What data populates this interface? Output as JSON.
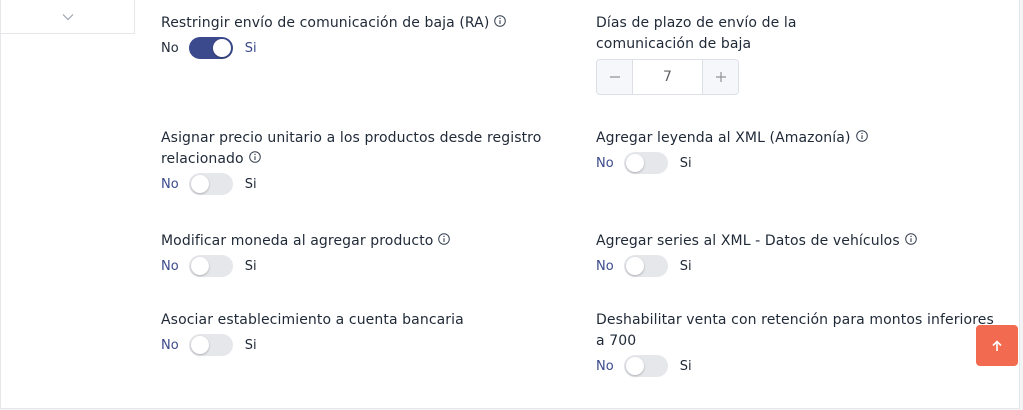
{
  "settings": {
    "restrict_ra": {
      "label": "Restringir envío de comunicación de baja (RA)",
      "no": "No",
      "yes": "Si",
      "state": "on"
    },
    "days_term": {
      "label_line1": "Días de plazo de envío de la",
      "label_line2": "comunicación de baja",
      "value": "7"
    },
    "assign_price": {
      "label_line1": "Asignar precio unitario a los productos desde registro",
      "label_line2": "relacionado",
      "no": "No",
      "yes": "Si",
      "state": "off"
    },
    "xml_legend": {
      "label": "Agregar leyenda al XML (Amazonía)",
      "no": "No",
      "yes": "Si",
      "state": "off"
    },
    "modify_currency": {
      "label": "Modificar moneda al agregar producto",
      "no": "No",
      "yes": "Si",
      "state": "off"
    },
    "xml_series": {
      "label": "Agregar series al XML - Datos de vehículos",
      "no": "No",
      "yes": "Si",
      "state": "off"
    },
    "bank_account": {
      "label": "Asociar establecimiento a cuenta bancaria",
      "no": "No",
      "yes": "Si",
      "state": "off"
    },
    "disable_retention": {
      "label_line1": "Deshabilitar venta con retención para montos inferiores",
      "label_line2": "a 700",
      "no": "No",
      "yes": "Si",
      "state": "off"
    }
  },
  "colors": {
    "accent": "#3b4a8c",
    "scroll_top": "#f26b50",
    "switch_off": "#e5e7eb"
  },
  "icons": {
    "collapse": "chevron-down-icon",
    "info": "info-icon",
    "scroll_top": "arrow-up-icon"
  }
}
